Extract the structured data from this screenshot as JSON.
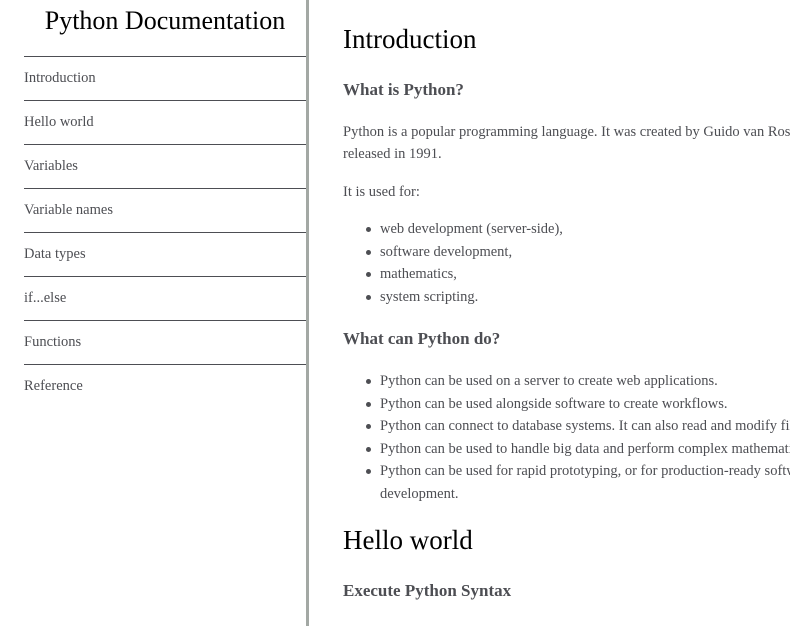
{
  "sidebar": {
    "title": "Python Documentation",
    "nav_items": [
      {
        "label": "Introduction"
      },
      {
        "label": "Hello world"
      },
      {
        "label": "Variables"
      },
      {
        "label": "Variable names"
      },
      {
        "label": "Data types"
      },
      {
        "label": "if...else"
      },
      {
        "label": "Functions"
      },
      {
        "label": "Reference"
      }
    ]
  },
  "main": {
    "introduction": {
      "title": "Introduction",
      "what_is": {
        "heading": "What is Python?",
        "paragraph_line1": "Python is a popular programming language. It was created by Guido van Rossum, and",
        "paragraph_line2": "released in 1991.",
        "used_for_label": "It is used for:",
        "used_for_items": [
          "web development (server-side),",
          "software development,",
          "mathematics,",
          "system scripting."
        ]
      },
      "what_can": {
        "heading": "What can Python do?",
        "items": [
          "Python can be used on a server to create web applications.",
          "Python can be used alongside software to create workflows.",
          "Python can connect to database systems. It can also read and modify files.",
          "Python can be used to handle big data and perform complex mathematics.",
          "Python can be used for rapid prototyping, or for production-ready software",
          "development."
        ]
      }
    },
    "hello_world": {
      "title": "Hello world",
      "sub_heading": "Execute Python Syntax"
    }
  }
}
